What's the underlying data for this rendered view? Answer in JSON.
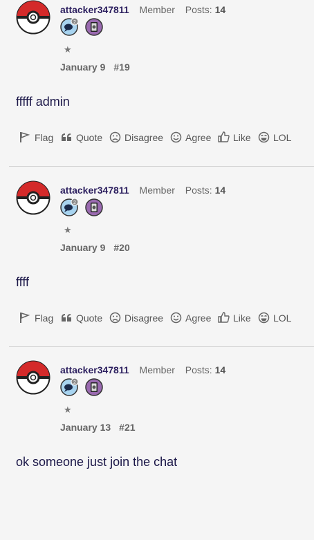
{
  "posts": [
    {
      "username": "attacker347811",
      "role": "Member",
      "posts_label": "Posts:",
      "posts_count": "14",
      "badge_count": "2",
      "star": "★",
      "date": "January 9",
      "post_num": "#19",
      "body": "fffff admin"
    },
    {
      "username": "attacker347811",
      "role": "Member",
      "posts_label": "Posts:",
      "posts_count": "14",
      "badge_count": "2",
      "star": "★",
      "date": "January 9",
      "post_num": "#20",
      "body": "ffff"
    },
    {
      "username": "attacker347811",
      "role": "Member",
      "posts_label": "Posts:",
      "posts_count": "14",
      "badge_count": "2",
      "star": "★",
      "date": "January 13",
      "post_num": "#21",
      "body": "ok someone just join the chat"
    }
  ],
  "actions": {
    "flag": "Flag",
    "quote": "Quote",
    "disagree": "Disagree",
    "agree": "Agree",
    "like": "Like",
    "lol": "LOL"
  },
  "colors": {
    "username": "#2b1e5e",
    "body_text": "#1b1748",
    "pokeball_red": "#d42a2a",
    "badge_blue": "#a8d4f0",
    "badge_purple": "#9a6ab0"
  }
}
